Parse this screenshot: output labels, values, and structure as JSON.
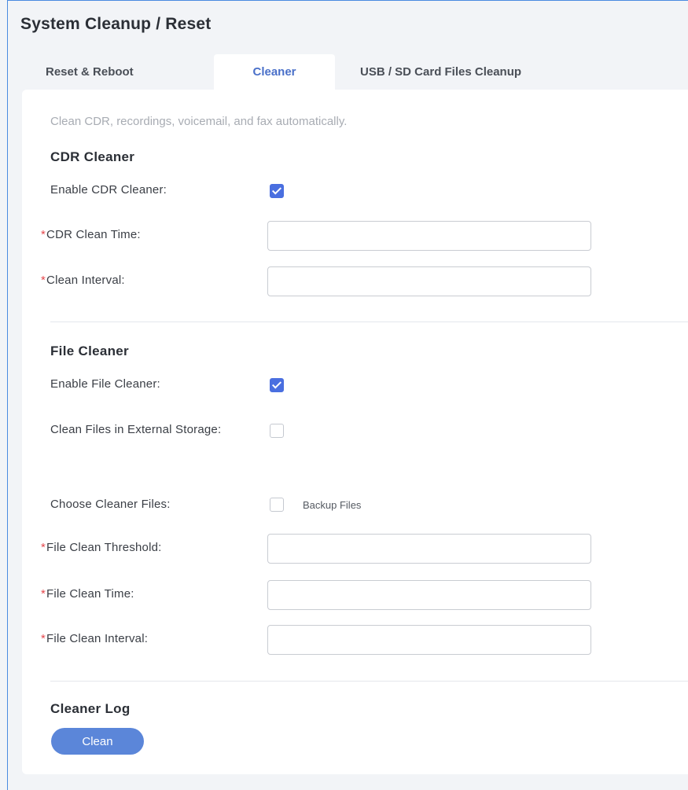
{
  "page": {
    "title": "System Cleanup / Reset"
  },
  "tabs": [
    {
      "label": "Reset & Reboot",
      "active": false
    },
    {
      "label": "Cleaner",
      "active": true
    },
    {
      "label": "USB / SD Card Files Cleanup",
      "active": false
    }
  ],
  "hint": "Clean CDR, recordings, voicemail, and fax automatically.",
  "cdr": {
    "title": "CDR Cleaner",
    "enable_label": "Enable CDR Cleaner:",
    "enable_checked": true,
    "clean_time_label": "CDR Clean Time:",
    "clean_time_value": "",
    "interval_label": "Clean Interval:",
    "interval_value": ""
  },
  "file": {
    "title": "File Cleaner",
    "enable_label": "Enable File Cleaner:",
    "enable_checked": true,
    "external_label": "Clean Files in External Storage:",
    "external_checked": false,
    "choose_label": "Choose Cleaner Files:",
    "backup_label": "Backup Files",
    "backup_checked": false,
    "threshold_label": "File Clean Threshold:",
    "threshold_value": "",
    "time_label": "File Clean Time:",
    "time_value": "",
    "interval_label": "File Clean Interval:",
    "interval_value": ""
  },
  "log": {
    "title": "Cleaner Log",
    "clean_button": "Clean"
  },
  "required_mark": "*",
  "colors": {
    "accent": "#4a6fe0",
    "button": "#5b86d9",
    "required": "#e5484d"
  }
}
